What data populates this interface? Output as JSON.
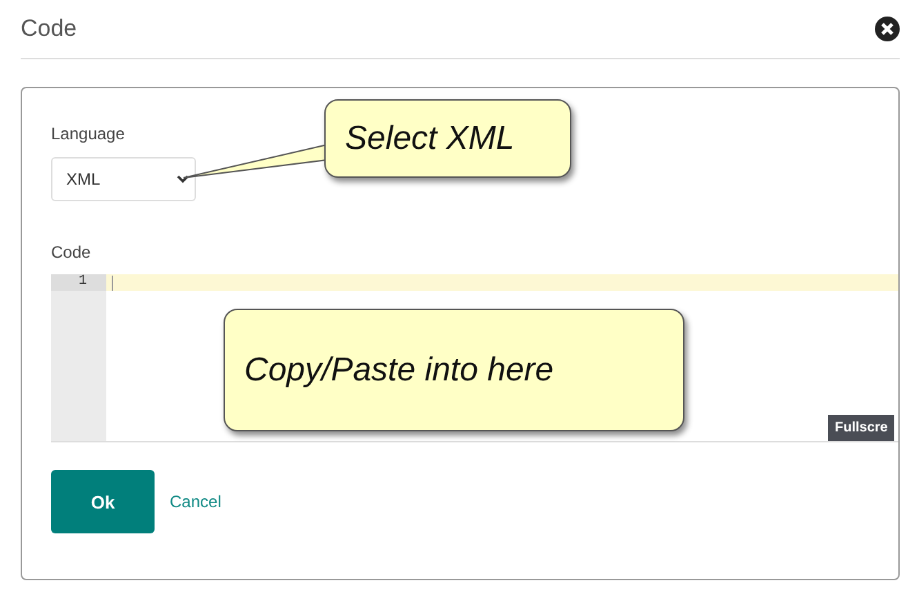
{
  "dialog": {
    "title": "Code",
    "language": {
      "label": "Language",
      "value": "XML"
    },
    "code": {
      "label": "Code",
      "line_numbers": [
        "1"
      ],
      "fullscreen_button": "Fullscre"
    },
    "buttons": [
      {
        "label": "Ok",
        "kind": "primary"
      },
      {
        "label": "Cancel",
        "kind": "link"
      }
    ]
  },
  "callouts": [
    {
      "text": "Select XML"
    },
    {
      "text": "Copy/Paste into here"
    }
  ]
}
